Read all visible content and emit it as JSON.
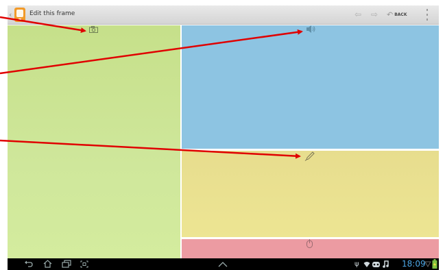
{
  "action_bar": {
    "title": "Edit this frame",
    "back_label": "BACK",
    "icons": [
      "back-caret-icon",
      "app-frame-icon",
      "undo-arrow-icon",
      "redo-arrow-icon",
      "back-icon",
      "overflow-menu-icon"
    ]
  },
  "panels": [
    {
      "name": "left",
      "color": "#c8e28c",
      "icon": "camera-icon"
    },
    {
      "name": "top-right",
      "color": "#8dc4e2",
      "icon": "speaker-icon"
    },
    {
      "name": "middle-right",
      "color": "#e9e08f",
      "icon": "pencil-icon"
    },
    {
      "name": "bottom-right",
      "color": "#ec9ba2",
      "icon": "mouse-icon"
    }
  ],
  "system_bar": {
    "time": "18:09",
    "nav_icons": [
      "back-icon",
      "home-icon",
      "recent-apps-icon",
      "screenshot-icon",
      "up-chevron-icon"
    ],
    "status_icons": [
      "usb-icon",
      "wifi-icon",
      "voicemail-icon",
      "music-icon",
      "battery-icon"
    ]
  },
  "colors": {
    "annotation_arrow": "#e00000",
    "clock": "#4da7e6"
  }
}
